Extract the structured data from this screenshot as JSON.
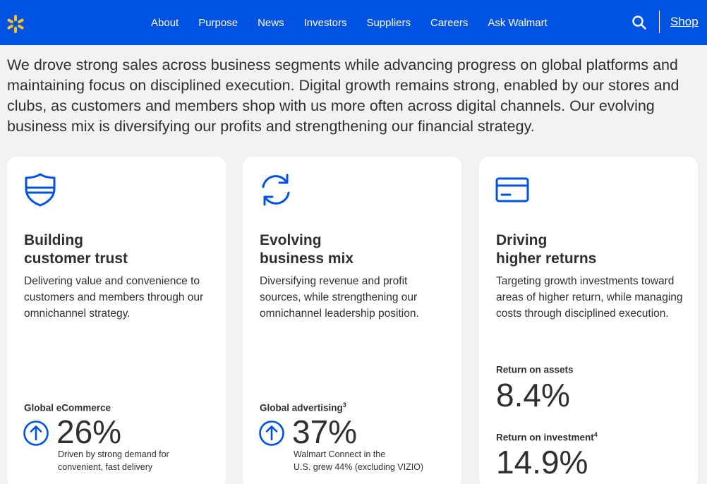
{
  "header": {
    "logo_icon": "walmart-spark-icon",
    "nav": [
      "About",
      "Purpose",
      "News",
      "Investors",
      "Suppliers",
      "Careers",
      "Ask Walmart"
    ],
    "search_icon": "search-icon",
    "shop_label": "Shop"
  },
  "intro": "We drove strong sales across business segments while advancing progress on global platforms and maintaining focus on disciplined execution. Digital growth remains strong, enabled by our stores and clubs, as customers and members shop with us more often across digital channels. Our evolving business mix is diversifying our profits and strengthening our financial strategy.",
  "cards": [
    {
      "icon": "shield-icon",
      "title_line1": "Building",
      "title_line2": "customer trust",
      "description": "Delivering value and convenience to customers and members through our omnichannel strategy.",
      "metric_label": "Global eCommerce",
      "metric_sup": "",
      "metric_value": "26%",
      "metric_icon": "arrow-up-circle-icon",
      "metric_note_line1": "Driven by strong demand for",
      "metric_note_line2": "convenient, fast delivery"
    },
    {
      "icon": "refresh-icon",
      "title_line1": "Evolving",
      "title_line2": "business mix",
      "description": "Diversifying revenue and profit sources, while strengthening our omnichannel leadership position.",
      "metric_label": "Global advertising",
      "metric_sup": "3",
      "metric_value": "37%",
      "metric_icon": "arrow-up-circle-icon",
      "metric_note_line1": "Walmart Connect in the",
      "metric_note_line2": "U.S. grew 44% (excluding VIZIO)"
    },
    {
      "icon": "credit-card-icon",
      "title_line1": "Driving",
      "title_line2": "higher returns",
      "description": "Targeting growth investments toward areas of higher return, while managing costs through disciplined execution.",
      "metrics": [
        {
          "label": "Return on assets",
          "sup": "",
          "value": "8.4%"
        },
        {
          "label": "Return on investment",
          "sup": "4",
          "value": "14.9%"
        }
      ]
    }
  ],
  "colors": {
    "brand_blue": "#0053e2",
    "spark_yellow": "#ffc220",
    "text": "#2e2f32",
    "page_bg": "#f2f2f2"
  }
}
